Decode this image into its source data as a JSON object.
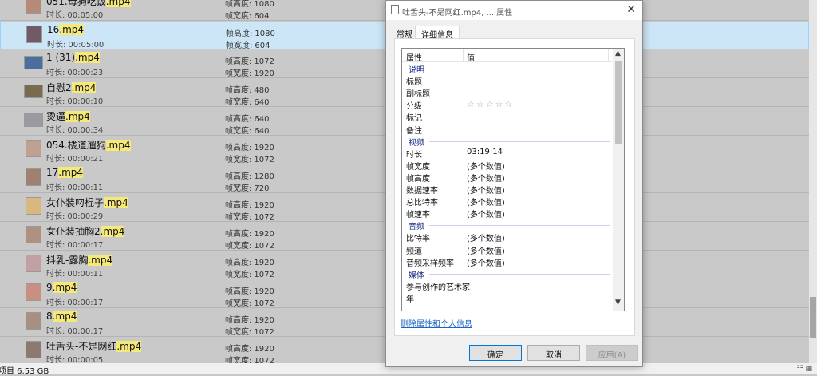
{
  "files": [
    {
      "name": "051.母狗吃饭",
      "ext": ".mp4",
      "duration_label": "时长:",
      "duration": "00:05:00",
      "dim1_label": "帧高度:",
      "dim1": "1080",
      "dim2_label": "帧宽度:",
      "dim2": "604",
      "selected": false
    },
    {
      "name": "16",
      "ext": ".mp4",
      "duration_label": "时长:",
      "duration": "00:05:00",
      "dim1_label": "帧高度:",
      "dim1": "1080",
      "dim2_label": "帧宽度:",
      "dim2": "604",
      "selected": true
    },
    {
      "name": "1 (31)",
      "ext": ".mp4",
      "duration_label": "时长:",
      "duration": "00:00:23",
      "dim1_label": "帧高度:",
      "dim1": "1072",
      "dim2_label": "帧宽度:",
      "dim2": "1920",
      "selected": false
    },
    {
      "name": "自慰2",
      "ext": ".mp4",
      "duration_label": "时长:",
      "duration": "00:00:10",
      "dim1_label": "帧高度:",
      "dim1": "480",
      "dim2_label": "帧宽度:",
      "dim2": "640",
      "selected": false
    },
    {
      "name": "烫逼",
      "ext": ".mp4",
      "duration_label": "时长:",
      "duration": "00:00:34",
      "dim1_label": "帧高度:",
      "dim1": "640",
      "dim2_label": "帧宽度:",
      "dim2": "640",
      "selected": false
    },
    {
      "name": "054.楼道遛狗",
      "ext": ".mp4",
      "duration_label": "时长:",
      "duration": "00:00:21",
      "dim1_label": "帧高度:",
      "dim1": "1920",
      "dim2_label": "帧宽度:",
      "dim2": "1072",
      "selected": false
    },
    {
      "name": "17",
      "ext": ".mp4",
      "duration_label": "时长:",
      "duration": "00:00:11",
      "dim1_label": "帧高度:",
      "dim1": "1280",
      "dim2_label": "帧宽度:",
      "dim2": "720",
      "selected": false
    },
    {
      "name": "女仆装叼棍子",
      "ext": ".mp4",
      "duration_label": "时长:",
      "duration": "00:00:29",
      "dim1_label": "帧高度:",
      "dim1": "1920",
      "dim2_label": "帧宽度:",
      "dim2": "1072",
      "selected": false
    },
    {
      "name": "女仆装抽胸2",
      "ext": ".mp4",
      "duration_label": "时长:",
      "duration": "00:00:17",
      "dim1_label": "帧高度:",
      "dim1": "1920",
      "dim2_label": "帧宽度:",
      "dim2": "1072",
      "selected": false
    },
    {
      "name": "抖乳-露胸",
      "ext": ".mp4",
      "duration_label": "时长:",
      "duration": "00:00:11",
      "dim1_label": "帧高度:",
      "dim1": "1920",
      "dim2_label": "帧宽度:",
      "dim2": "1072",
      "selected": false
    },
    {
      "name": "9",
      "ext": ".mp4",
      "duration_label": "时长:",
      "duration": "00:00:17",
      "dim1_label": "帧高度:",
      "dim1": "1920",
      "dim2_label": "帧宽度:",
      "dim2": "1072",
      "selected": false
    },
    {
      "name": "8",
      "ext": ".mp4",
      "duration_label": "时长:",
      "duration": "00:00:17",
      "dim1_label": "帧高度:",
      "dim1": "1920",
      "dim2_label": "帧宽度:",
      "dim2": "1072",
      "selected": false
    },
    {
      "name": "吐舌头-不是网红",
      "ext": ".mp4",
      "duration_label": "时长:",
      "duration": "00:00:05",
      "dim1_label": "帧高度:",
      "dim1": "1920",
      "dim2_label": "帧宽度:",
      "dim2": "1072",
      "selected": false
    }
  ],
  "status": {
    "text": "项目 6.53 GB"
  },
  "dialog": {
    "title": "吐舌头-不是网红.mp4, ... 属性",
    "close_icon": "close-icon",
    "tabs": [
      "常规",
      "详细信息"
    ],
    "active_tab": "详细信息",
    "header": {
      "prop": "属性",
      "value": "值"
    },
    "rows": [
      {
        "kind": "group",
        "key": "说明"
      },
      {
        "kind": "prop",
        "key": "标题",
        "value": ""
      },
      {
        "kind": "prop",
        "key": "副标题",
        "value": ""
      },
      {
        "kind": "prop",
        "key": "分级",
        "value": "☆☆☆☆☆",
        "stars": true
      },
      {
        "kind": "prop",
        "key": "标记",
        "value": ""
      },
      {
        "kind": "prop",
        "key": "备注",
        "value": ""
      },
      {
        "kind": "group",
        "key": "视频"
      },
      {
        "kind": "prop",
        "key": "时长",
        "value": "03:19:14"
      },
      {
        "kind": "prop",
        "key": "帧宽度",
        "value": "(多个数值)"
      },
      {
        "kind": "prop",
        "key": "帧高度",
        "value": "(多个数值)"
      },
      {
        "kind": "prop",
        "key": "数据速率",
        "value": "(多个数值)"
      },
      {
        "kind": "prop",
        "key": "总比特率",
        "value": "(多个数值)"
      },
      {
        "kind": "prop",
        "key": "帧速率",
        "value": "(多个数值)"
      },
      {
        "kind": "group",
        "key": "音频"
      },
      {
        "kind": "prop",
        "key": "比特率",
        "value": "(多个数值)"
      },
      {
        "kind": "prop",
        "key": "频道",
        "value": "(多个数值)"
      },
      {
        "kind": "prop",
        "key": "音频采样频率",
        "value": "(多个数值)"
      },
      {
        "kind": "group",
        "key": "媒体"
      },
      {
        "kind": "prop",
        "key": "参与创作的艺术家",
        "value": ""
      },
      {
        "kind": "prop",
        "key": "年",
        "value": ""
      }
    ],
    "remove_link": "删除属性和个人信息",
    "buttons": {
      "ok": "确定",
      "cancel": "取消",
      "apply": "应用(A)"
    }
  }
}
